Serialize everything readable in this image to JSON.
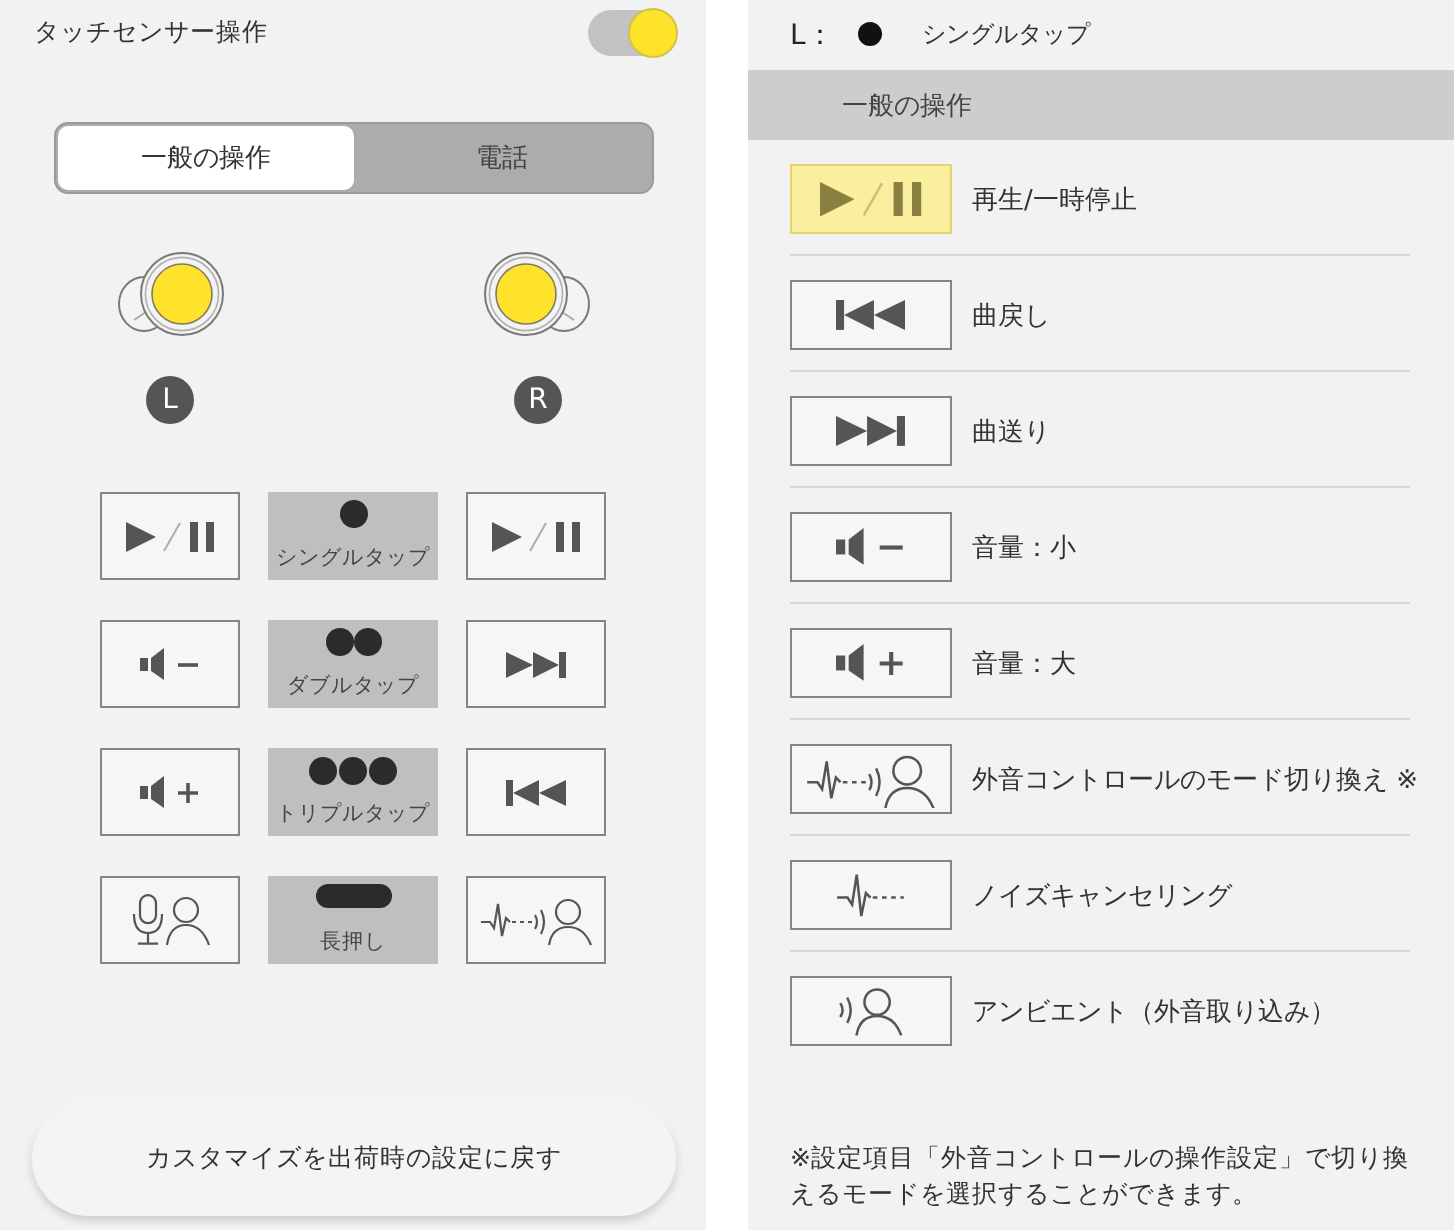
{
  "left_panel": {
    "title": "タッチセンサー操作",
    "toggle_on": true,
    "tabs": [
      {
        "label": "一般の操作",
        "selected": true
      },
      {
        "label": "電話",
        "selected": false
      }
    ],
    "earbuds": [
      {
        "kind": "left",
        "side": "L"
      },
      {
        "kind": "right",
        "side": "R"
      }
    ],
    "gesture_rows": [
      {
        "left_action": {
          "kind": "play_pause"
        },
        "gesture": {
          "kind": "single",
          "label": "シングルタップ"
        },
        "right_action": {
          "kind": "play_pause"
        }
      },
      {
        "left_action": {
          "kind": "volume_down"
        },
        "gesture": {
          "kind": "double",
          "label": "ダブルタップ"
        },
        "right_action": {
          "kind": "next"
        }
      },
      {
        "left_action": {
          "kind": "volume_up"
        },
        "gesture": {
          "kind": "triple",
          "label": "トリプルタップ"
        },
        "right_action": {
          "kind": "previous"
        }
      },
      {
        "left_action": {
          "kind": "voice_assist"
        },
        "gesture": {
          "kind": "long",
          "label": "長押し"
        },
        "right_action": {
          "kind": "ambient_switch"
        }
      }
    ],
    "reset_button": "カスタマイズを出荷時の設定に戻す"
  },
  "right_panel": {
    "selection": {
      "side_label": "L：",
      "gesture": {
        "kind": "single",
        "label": "シングルタップ"
      }
    },
    "section_title": "一般の操作",
    "actions": [
      {
        "kind": "play_pause",
        "label": "再生/一時停止",
        "selected": true
      },
      {
        "kind": "previous",
        "label": "曲戻し",
        "selected": false
      },
      {
        "kind": "next",
        "label": "曲送り",
        "selected": false
      },
      {
        "kind": "volume_down",
        "label": "音量：小",
        "selected": false
      },
      {
        "kind": "volume_up",
        "label": "音量：大",
        "selected": false
      },
      {
        "kind": "ambient_switch",
        "label": "外音コントロールのモード切り換え ※",
        "selected": false
      },
      {
        "kind": "noise_canceling",
        "label": "ノイズキャンセリング",
        "selected": false
      },
      {
        "kind": "ambient",
        "label": "アンビエント（外音取り込み）",
        "selected": false
      }
    ],
    "footnote": "※設定項目「外音コントロールの操作設定」で切り換えるモードを選択することができます。"
  }
}
